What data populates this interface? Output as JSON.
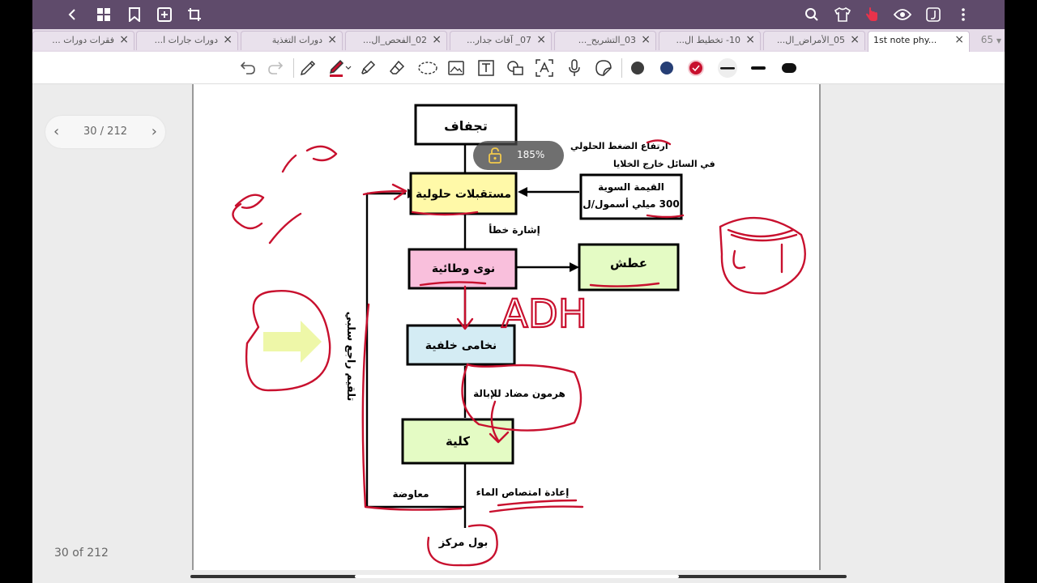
{
  "tabs": [
    {
      "label": "فقرات دورات ..."
    },
    {
      "label": "دورات جارات ا..."
    },
    {
      "label": "دورات التغذية"
    },
    {
      "label": "02_الفحص_ال..."
    },
    {
      "label": "07_ آفات جدار..."
    },
    {
      "label": "03_التشريح_..."
    },
    {
      "label": "10- تخطيط ال..."
    },
    {
      "label": "05_الأمراض_ال..."
    },
    {
      "label": "1st note phy..."
    }
  ],
  "tab_close": "×",
  "tab_count": "65",
  "page_nav": {
    "label": "30 / 212",
    "prev": "‹",
    "next": "›"
  },
  "page_count": "30 of 212",
  "zoom": "185%",
  "diagram": {
    "dehydration": "تجفاف",
    "high_pressure_1": "ارتفاع الضغط الحلولي",
    "high_pressure_2": "في السائل خارج الخلايا",
    "osmoreceptors": "مستقبلات حلولية",
    "normal_value_1": "القيمة السوية",
    "normal_value_2": "300 ميلي أسمول/ل",
    "error_signal": "إشارة خطأ",
    "hypothalamic_nuclei": "نوى وطائية",
    "thirst": "عطش",
    "posterior_pituitary": "نخامى خلفية",
    "negative_feedback": "تلقيم راجع سلبي",
    "adh_hormone": "هرمون مضاد للإبالة",
    "kidney": "كلية",
    "compensation": "معاوضة",
    "water_reabsorption": "إعادة امتصاص الماء",
    "concentrated_urine": "بول مركز"
  },
  "annotations": {
    "adh": "ADH"
  },
  "colors": {
    "topbar": "#5f4b6b",
    "ink_red": "#c8102e",
    "box_yellow": "#fff9a8",
    "box_pink": "#f9bfdc",
    "box_green": "#e4fbc4",
    "box_blue": "#d4ecf4"
  }
}
